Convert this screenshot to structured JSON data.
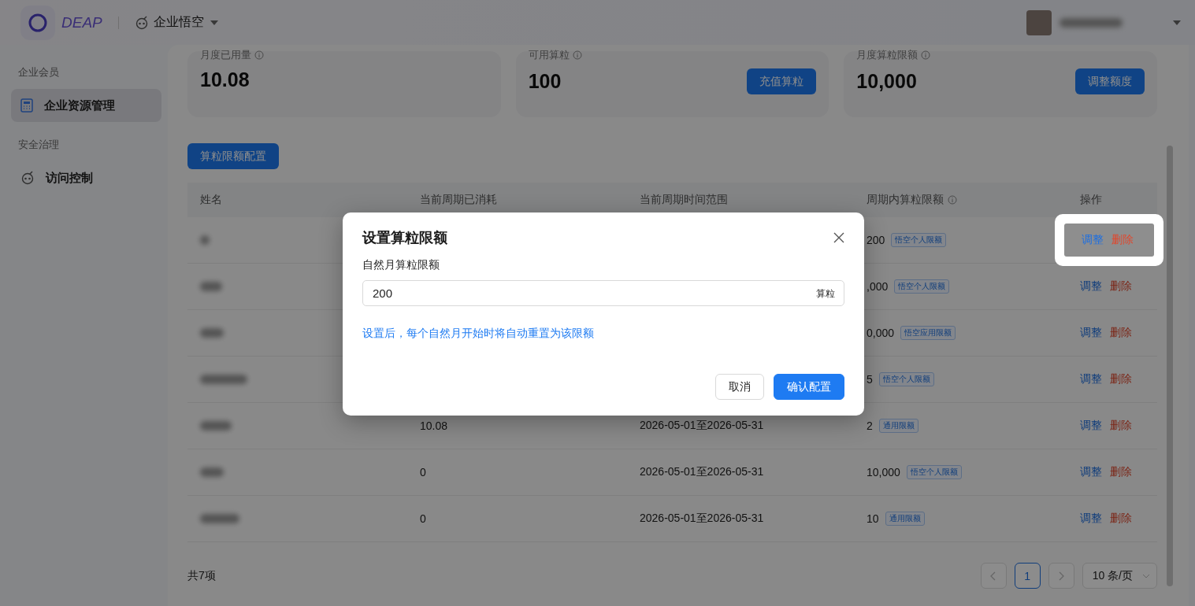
{
  "header": {
    "logo": "DEAP",
    "workspace": "企业悟空"
  },
  "sidebar": {
    "groups": [
      {
        "title": "企业会员",
        "items": [
          {
            "label": "企业资源管理",
            "selected": true
          }
        ]
      },
      {
        "title": "安全治理",
        "items": [
          {
            "label": "访问控制",
            "selected": false
          }
        ]
      }
    ]
  },
  "stats": [
    {
      "label": "月度已用量",
      "value": "10.08"
    },
    {
      "label": "可用算粒",
      "value": "100",
      "action": "充值算粒"
    },
    {
      "label": "月度算粒限额",
      "value": "10,000",
      "action": "调整额度"
    }
  ],
  "config_button": "算粒限额配置",
  "table": {
    "columns": [
      {
        "label": "姓名",
        "info": false
      },
      {
        "label": "当前周期已消耗",
        "info": false
      },
      {
        "label": "当前周期时间范围",
        "info": false
      },
      {
        "label": "周期内算粒限额",
        "info": true
      },
      {
        "label": "操作",
        "info": false
      }
    ],
    "rows": [
      {
        "limit": "200",
        "tag": "悟空个人限额",
        "highlighted": true,
        "actions": [
          "调整",
          "删除"
        ]
      },
      {
        "limit": ",000",
        "tag": "悟空个人限额",
        "highlighted": false,
        "actions": [
          "调整",
          "删除"
        ]
      },
      {
        "limit": "0,000",
        "tag": "悟空应用限额",
        "highlighted": false,
        "actions": [
          "调整",
          "删除"
        ]
      },
      {
        "limit": "5",
        "tag": "悟空个人限额",
        "highlighted": false,
        "actions": [
          "调整",
          "删除"
        ]
      },
      {
        "consumed": "10.08",
        "range": "2026-05-01至2026-05-31",
        "limit": "2",
        "tag": "通用限额",
        "highlighted": false,
        "actions": [
          "调整",
          "删除"
        ]
      },
      {
        "consumed": "0",
        "range": "2026-05-01至2026-05-31",
        "limit": "10,000",
        "tag": "悟空个人限额",
        "highlighted": false,
        "actions": [
          "调整",
          "删除"
        ]
      },
      {
        "consumed": "0",
        "range": "2026-05-01至2026-05-31",
        "limit": "10",
        "tag": "通用限额",
        "highlighted": false,
        "actions": [
          "调整",
          "删除"
        ]
      }
    ]
  },
  "pagination": {
    "total": "共7项",
    "pages": [
      {
        "label": "1",
        "selected": true
      }
    ],
    "page_size": "10 条/页"
  },
  "modal": {
    "title": "设置算粒限额",
    "field_label": "自然月算粒限额",
    "value": "200",
    "suffix": "算粒",
    "hint": "设置后，每个自然月开始时将自动重置为该限额",
    "buttons": [
      {
        "label": "取消",
        "kind": "secondary"
      },
      {
        "label": "确认配置",
        "kind": "primary"
      }
    ]
  }
}
